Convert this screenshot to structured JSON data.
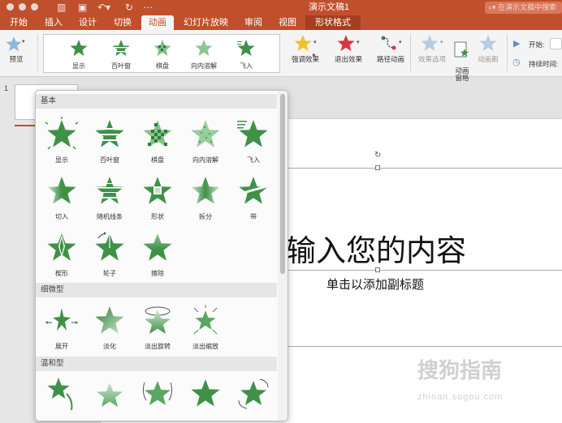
{
  "window": {
    "title": "演示文稿1",
    "search_placeholder": "在演示文稿中搜索"
  },
  "tabs": [
    {
      "label": "开始"
    },
    {
      "label": "插入"
    },
    {
      "label": "设计"
    },
    {
      "label": "切换"
    },
    {
      "label": "动画"
    },
    {
      "label": "幻灯片放映"
    },
    {
      "label": "审阅"
    },
    {
      "label": "视图"
    },
    {
      "label": "形状格式"
    }
  ],
  "ribbon": {
    "preview": "预览",
    "gallery": [
      "显示",
      "百叶窗",
      "棋盘",
      "向内溶解",
      "飞入"
    ],
    "emphasis": "强调效果",
    "exit": "退出效果",
    "path": "路径动画",
    "effect_options": "效果选项",
    "animation_pane": "动画\n窗格",
    "animation_painter": "动画刷",
    "start_label": "开始:",
    "duration_label": "持续时间:"
  },
  "thumbnails": {
    "number": "1"
  },
  "slide": {
    "title": "输入您的内容",
    "subtitle": "单击以添加副标题"
  },
  "panel": {
    "sections": [
      {
        "title": "基本",
        "items": [
          "显示",
          "百叶窗",
          "棋盘",
          "向内溶解",
          "飞入",
          "切入",
          "随机线条",
          "形状",
          "拆分",
          "带",
          "楔形",
          "轮子",
          "擦除"
        ]
      },
      {
        "title": "细微型",
        "items": [
          "展开",
          "淡化",
          "淡出旋转",
          "淡出缩放"
        ]
      },
      {
        "title": "温和型",
        "items": [
          "",
          "",
          "",
          "",
          ""
        ]
      }
    ]
  },
  "watermark": {
    "text": "搜狗指南",
    "url": "zhinan.sogou.com"
  },
  "colors": {
    "accent": "#c0502c",
    "star_green": "#3f9148",
    "emphasis_star": "#f2c12e",
    "exit_star": "#d9363e"
  }
}
